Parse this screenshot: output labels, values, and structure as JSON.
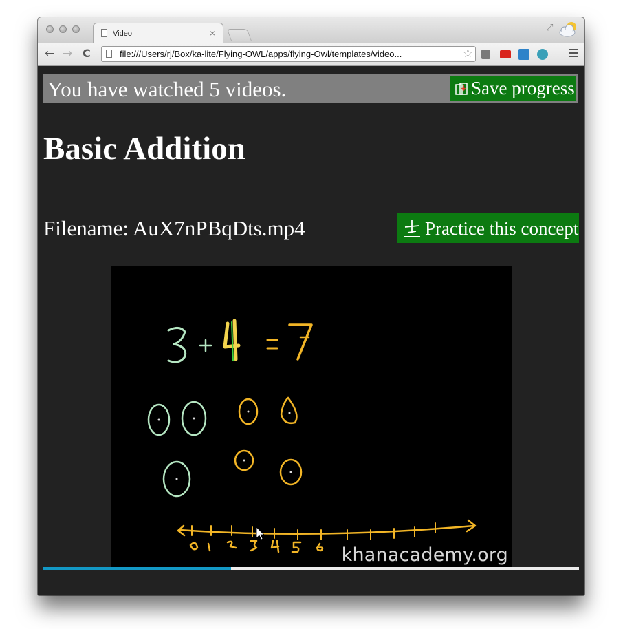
{
  "browser": {
    "tab_title": "Video",
    "tab_close": "×",
    "url": "file:///Users/rj/Box/ka-lite/Flying-OWL/apps/flying-Owl/templates/video...",
    "back_glyph": "←",
    "forward_glyph": "→",
    "reload_glyph": "C",
    "bookmark_glyph": "☆",
    "fullscreen_glyph": "⤢"
  },
  "progress": {
    "message": "You have watched 5 videos.",
    "save_label": "Save progress"
  },
  "video": {
    "title": "Basic Addition",
    "filename_label": "Filename:",
    "filename": "AuX7nPBqDts.mp4",
    "practice_label": "Practice this concept",
    "watermark": "khanacademy.org",
    "played_fraction": 0.35,
    "colors": {
      "played": "#1398c5",
      "button": "#0c7a11",
      "chalk_green": "#b5e6c2",
      "chalk_yellow": "#f2b526"
    }
  }
}
